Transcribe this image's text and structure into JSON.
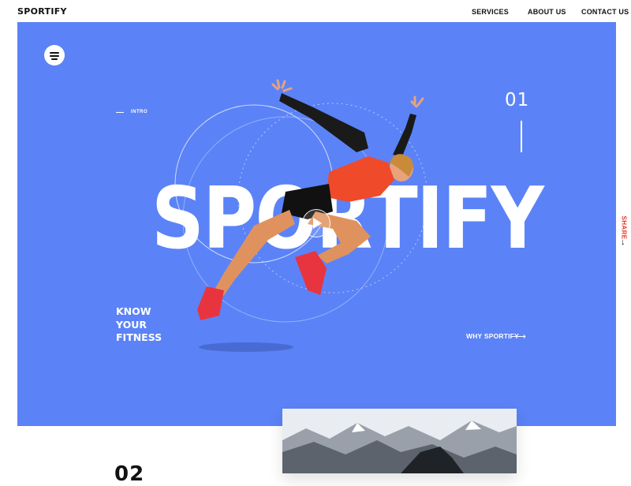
{
  "header": {
    "logo": "SPORTIFY",
    "nav": [
      {
        "label": "SERVICES"
      },
      {
        "label": "ABOUT US"
      },
      {
        "label": "CONTACT US"
      }
    ]
  },
  "hero": {
    "intro": "INTRO",
    "slide_number": "01",
    "title": "SPORTIFY",
    "tagline": [
      "KNOW",
      "YOUR",
      "FITNESS"
    ],
    "why_link": "WHY SPORTIFY",
    "background_color": "#5b83f7"
  },
  "side": {
    "share": "SHARE",
    "share_color": "#e53c2a"
  },
  "section_two": {
    "number": "02"
  },
  "icons": {
    "menu": "hamburger-menu-icon",
    "play": "play-icon",
    "arrow_right": "arrow-right-icon",
    "arrow_down": "arrow-down-icon"
  }
}
